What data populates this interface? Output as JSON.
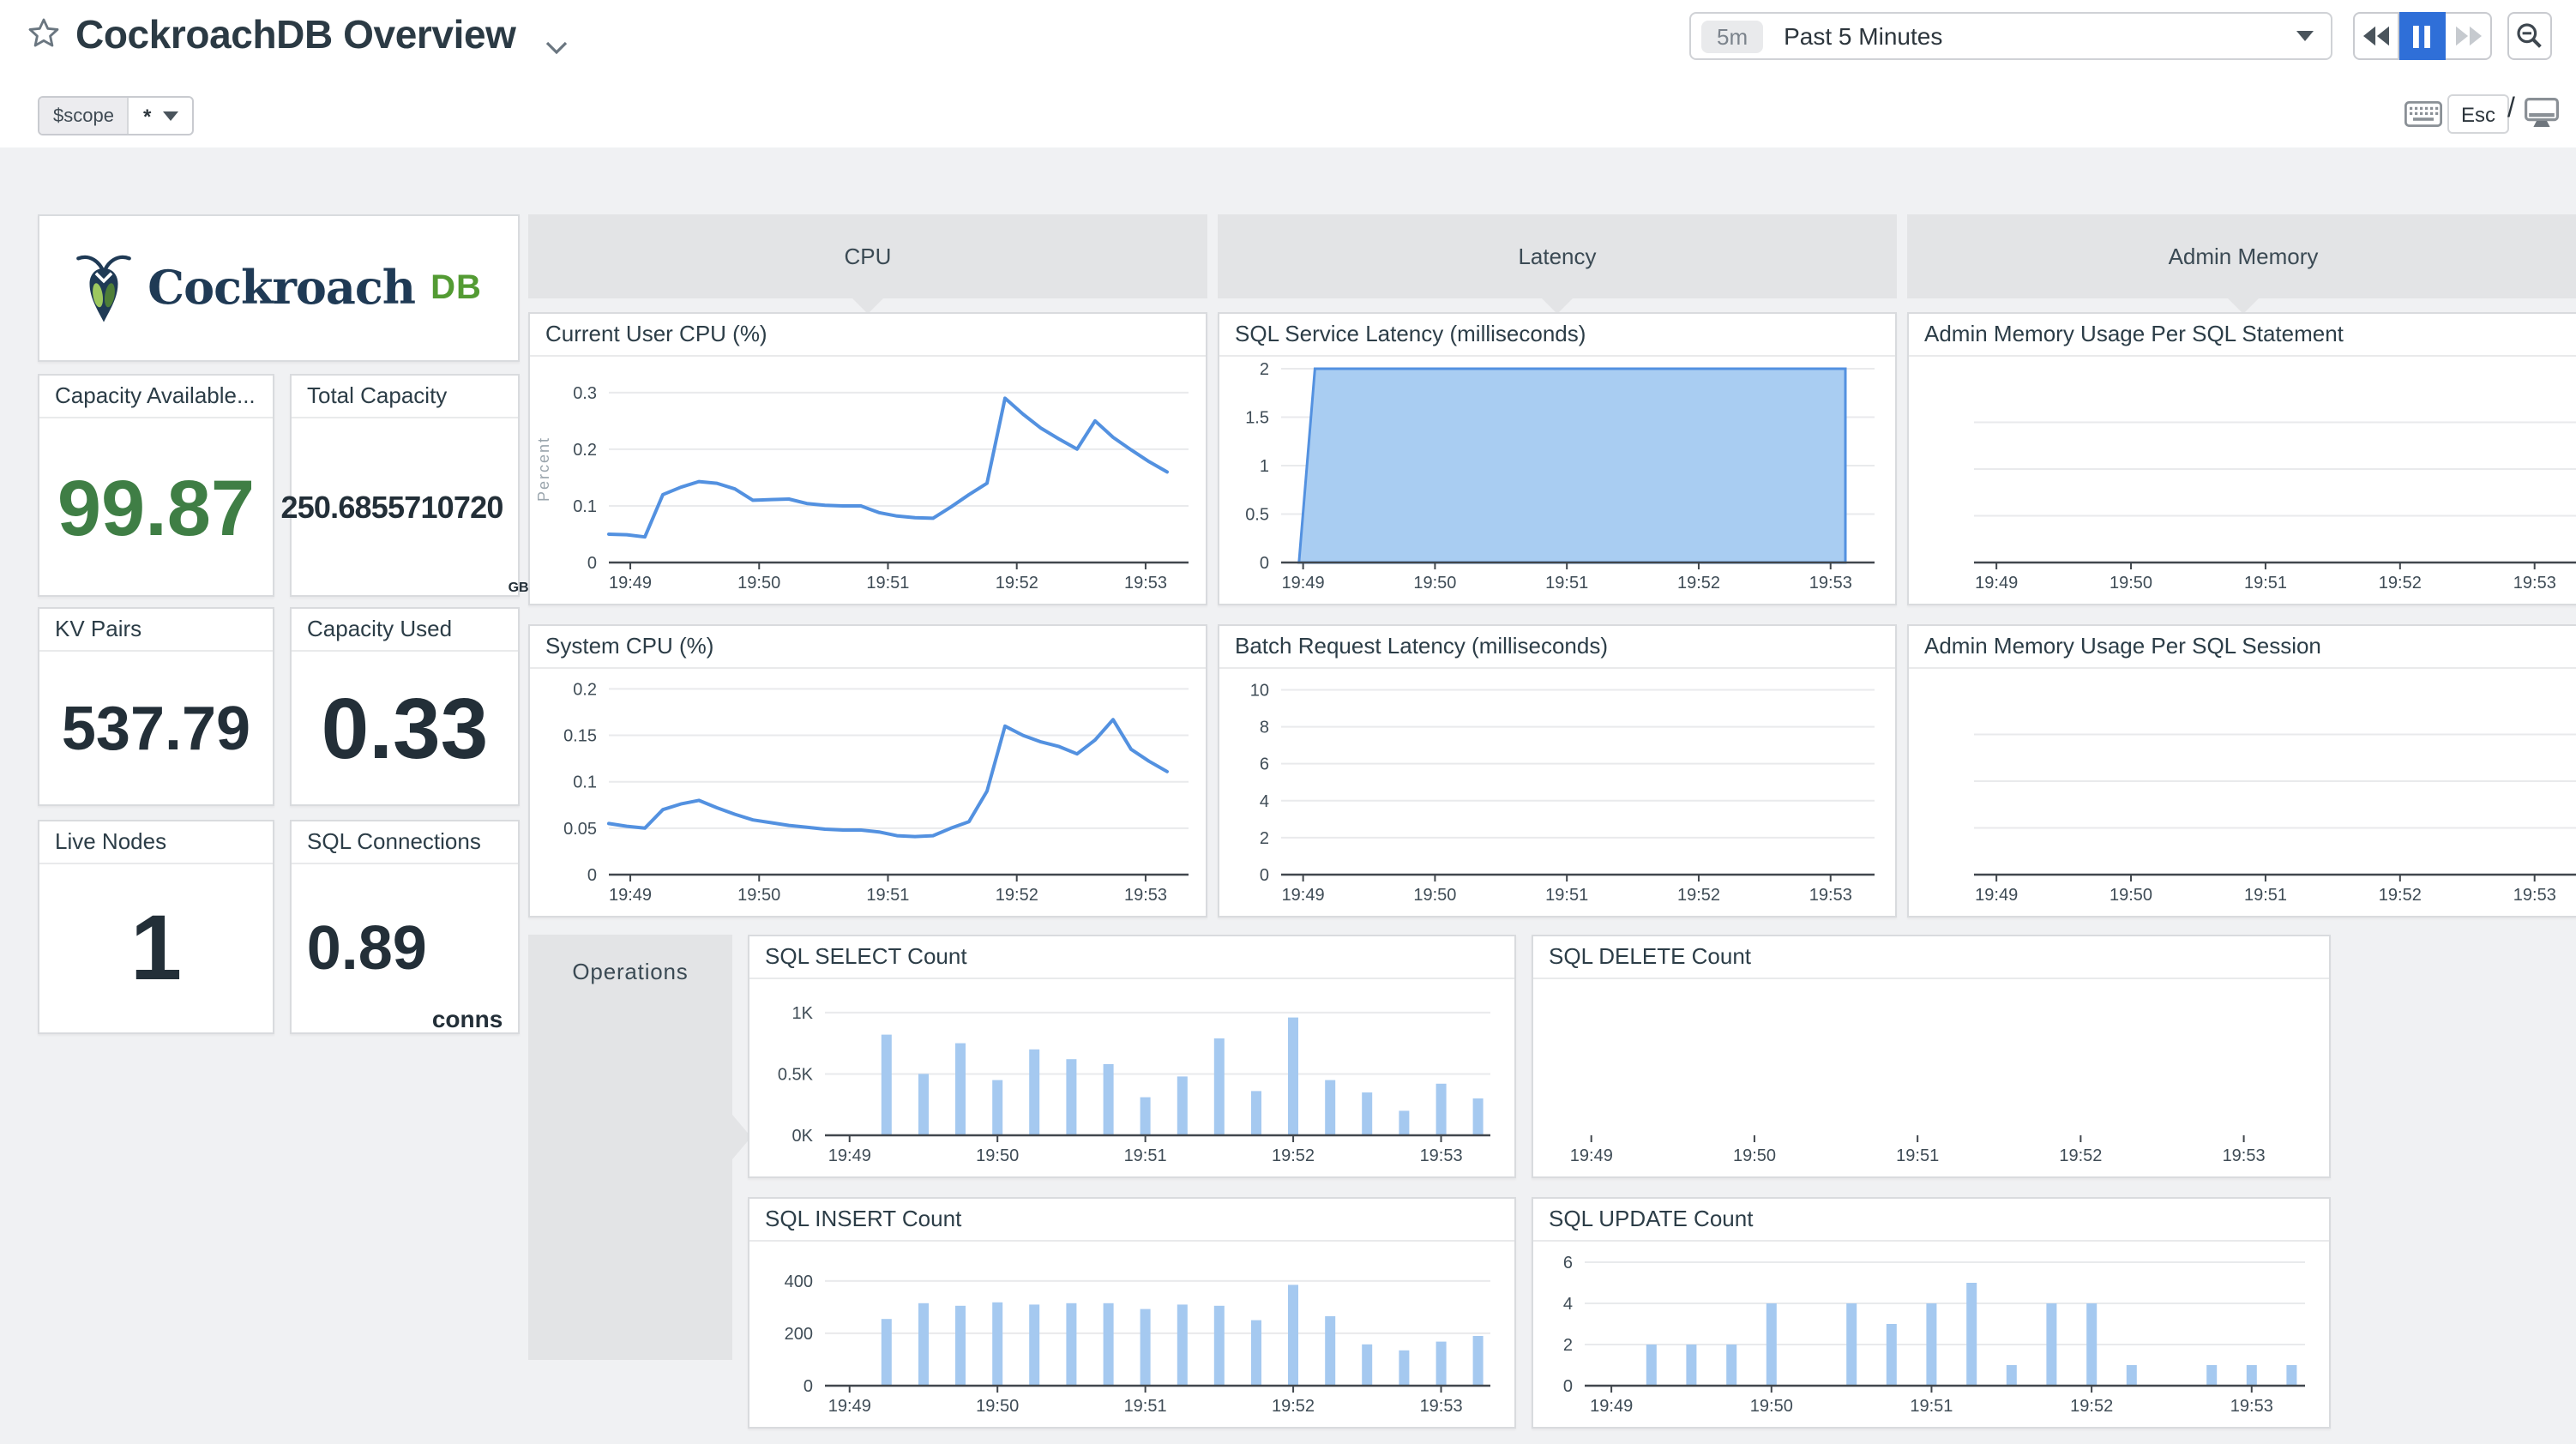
{
  "header": {
    "title": "CockroachDB Overview",
    "template_var": {
      "name": "$scope",
      "value": "*"
    },
    "time": {
      "badge": "5m",
      "label": "Past 5 Minutes"
    },
    "esc": "Esc",
    "slash": "/"
  },
  "logo": {
    "word": "Cockroach",
    "suffix": "DB"
  },
  "stats": [
    {
      "title": "Capacity Available...",
      "value": "99.87",
      "unit": ""
    },
    {
      "title": "Total Capacity",
      "value": "250.6855710720",
      "unit": "GB"
    },
    {
      "title": "KV Pairs",
      "value": "537.79",
      "unit": ""
    },
    {
      "title": "Capacity Used",
      "value": "0.33",
      "unit": ""
    },
    {
      "title": "Live Nodes",
      "value": "1",
      "unit": ""
    },
    {
      "title": "SQL Connections",
      "value": "0.89",
      "unit": "conns"
    }
  ],
  "groups": {
    "cpu": "CPU",
    "latency": "Latency",
    "admin_memory": "Admin Memory",
    "operations": "Operations"
  },
  "colors": {
    "line_blue": "#5391e0",
    "bar_blue": "#a5c9f0",
    "area_fill": "#a9cdf2",
    "active_button_blue": "#2f6fd8",
    "stat_green": "#3f7e45",
    "logo_navy": "#1f3a55",
    "logo_green": "#539b33"
  },
  "chart_data": [
    {
      "id": "current-user-cpu",
      "type": "line",
      "title": "Current User CPU (%)",
      "ylabel": "Percent",
      "ymax_display": 0.33,
      "yticks": [
        {
          "v": 0,
          "label": "0"
        },
        {
          "v": 0.1,
          "label": "0.1"
        },
        {
          "v": 0.2,
          "label": "0.2"
        },
        {
          "v": 0.3,
          "label": "0.3"
        }
      ],
      "xticks": [
        "19:49",
        "19:50",
        "19:51",
        "19:52",
        "19:53"
      ],
      "values": [
        0.05,
        0.049,
        0.045,
        0.12,
        0.133,
        0.143,
        0.14,
        0.13,
        0.11,
        0.111,
        0.112,
        0.104,
        0.101,
        0.1,
        0.1,
        0.088,
        0.082,
        0.079,
        0.078,
        0.098,
        0.12,
        0.14,
        0.29,
        0.262,
        0.237,
        0.218,
        0.2,
        0.25,
        0.221,
        0.199,
        0.178,
        0.16
      ]
    },
    {
      "id": "system-cpu",
      "type": "line",
      "title": "System CPU (%)",
      "ymax_display": 0.205,
      "yticks": [
        {
          "v": 0,
          "label": "0"
        },
        {
          "v": 0.05,
          "label": "0.05"
        },
        {
          "v": 0.1,
          "label": "0.1"
        },
        {
          "v": 0.15,
          "label": "0.15"
        },
        {
          "v": 0.2,
          "label": "0.2"
        }
      ],
      "xticks": [
        "19:49",
        "19:50",
        "19:51",
        "19:52",
        "19:53"
      ],
      "values": [
        0.055,
        0.052,
        0.05,
        0.07,
        0.076,
        0.08,
        0.072,
        0.065,
        0.059,
        0.056,
        0.053,
        0.051,
        0.049,
        0.048,
        0.048,
        0.046,
        0.042,
        0.041,
        0.042,
        0.05,
        0.057,
        0.09,
        0.16,
        0.15,
        0.143,
        0.138,
        0.13,
        0.145,
        0.167,
        0.135,
        0.122,
        0.111
      ]
    },
    {
      "id": "sql-service-latency",
      "type": "area",
      "title": "SQL Service Latency (milliseconds)",
      "ymax_display": 2,
      "yticks": [
        {
          "v": 0,
          "label": "0"
        },
        {
          "v": 0.5,
          "label": "0.5"
        },
        {
          "v": 1,
          "label": "1"
        },
        {
          "v": 1.5,
          "label": "1.5"
        },
        {
          "v": 2,
          "label": "2"
        }
      ],
      "xticks": [
        "19:49",
        "19:50",
        "19:51",
        "19:52",
        "19:53"
      ],
      "polygon": [
        [
          0.03,
          0
        ],
        [
          0.057,
          2
        ],
        [
          0.951,
          2
        ],
        [
          0.951,
          0
        ]
      ]
    },
    {
      "id": "batch-request-latency",
      "type": "empty",
      "title": "Batch Request Latency (milliseconds)",
      "ymax_display": 10.3,
      "yticks": [
        {
          "v": 0,
          "label": "0"
        },
        {
          "v": 2,
          "label": "2"
        },
        {
          "v": 4,
          "label": "4"
        },
        {
          "v": 6,
          "label": "6"
        },
        {
          "v": 8,
          "label": "8"
        },
        {
          "v": 10,
          "label": "10"
        }
      ],
      "xticks": [
        "19:49",
        "19:50",
        "19:51",
        "19:52",
        "19:53"
      ]
    },
    {
      "id": "admin-memory-per-sql-statement",
      "type": "empty",
      "title": "Admin Memory Usage Per SQL Statement",
      "xticks": [
        "19:49",
        "19:50",
        "19:51",
        "19:52",
        "19:53"
      ]
    },
    {
      "id": "admin-memory-per-sql-session",
      "type": "empty",
      "title": "Admin Memory Usage Per SQL Session",
      "xticks": [
        "19:49",
        "19:50",
        "19:51",
        "19:52",
        "19:53"
      ]
    },
    {
      "id": "sql-select-count",
      "type": "bar",
      "title": "SQL SELECT Count",
      "ymax_display": 1.09,
      "yticks": [
        {
          "v": 0,
          "label": "0K"
        },
        {
          "v": 0.5,
          "label": "0.5K"
        },
        {
          "v": 1,
          "label": "1K"
        }
      ],
      "xticks": [
        "19:49",
        "19:50",
        "19:51",
        "19:52",
        "19:53"
      ],
      "values": [
        0.82,
        0.5,
        0.75,
        0.45,
        0.7,
        0.62,
        0.58,
        0.31,
        0.48,
        0.79,
        0.36,
        0.96,
        0.45,
        0.35,
        0.2,
        0.42,
        0.3
      ]
    },
    {
      "id": "sql-delete-count",
      "type": "empty",
      "title": "SQL DELETE Count",
      "xticks": [
        "19:49",
        "19:50",
        "19:51",
        "19:52",
        "19:53"
      ]
    },
    {
      "id": "sql-insert-count",
      "type": "bar",
      "title": "SQL INSERT Count",
      "ymax_display": 465,
      "yticks": [
        {
          "v": 0,
          "label": "0"
        },
        {
          "v": 200,
          "label": "200"
        },
        {
          "v": 400,
          "label": "400"
        }
      ],
      "xticks": [
        "19:49",
        "19:50",
        "19:51",
        "19:52",
        "19:53"
      ],
      "values": [
        255,
        315,
        305,
        318,
        310,
        315,
        315,
        293,
        310,
        305,
        250,
        385,
        265,
        158,
        135,
        168,
        190
      ]
    },
    {
      "id": "sql-update-count",
      "type": "bar",
      "title": "SQL UPDATE Count",
      "ymax_display": 6.25,
      "yticks": [
        {
          "v": 0,
          "label": "0"
        },
        {
          "v": 2,
          "label": "2"
        },
        {
          "v": 4,
          "label": "4"
        },
        {
          "v": 6,
          "label": "6"
        }
      ],
      "xticks": [
        "19:49",
        "19:50",
        "19:51",
        "19:52",
        "19:53"
      ],
      "values": [
        2,
        2,
        2,
        4,
        null,
        4,
        3,
        4,
        5,
        1,
        4,
        4,
        1,
        null,
        1,
        1,
        1
      ]
    }
  ]
}
